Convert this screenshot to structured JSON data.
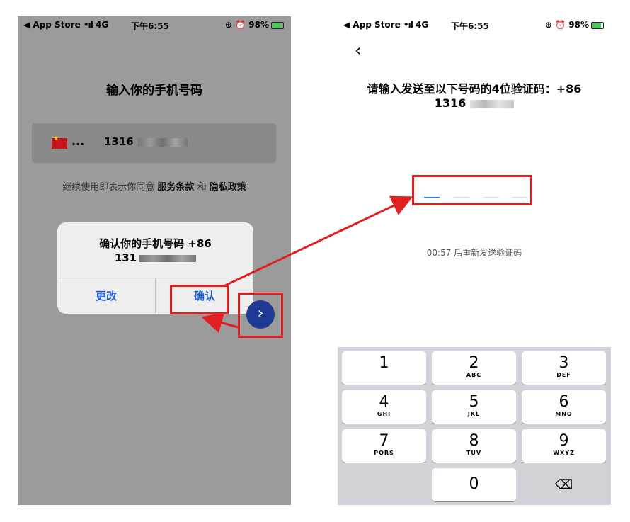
{
  "left_screen": {
    "status": {
      "carrier": "◀ App Store",
      "signal": "•ıl",
      "network": "4G",
      "time": "下午6:55",
      "icons": "⊕ ⏰",
      "battery": "98%"
    },
    "title": "输入你的手机号码",
    "phone_row": {
      "dots": "...",
      "number_prefix": "1316"
    },
    "terms": {
      "prefix": "继续使用即表示你同意",
      "terms_link": "服务条款",
      "and": "和",
      "privacy_link": "隐私政策"
    },
    "alert": {
      "title_line1": "确认你的手机号码 +86",
      "title_line2_prefix": "131",
      "change_label": "更改",
      "confirm_label": "确认"
    },
    "next_icon": "›"
  },
  "right_screen": {
    "status": {
      "carrier": "◀ App Store",
      "signal": "•ıl",
      "network": "4G",
      "time": "下午6:55",
      "icons": "⊕ ⏰",
      "battery": "98%"
    },
    "back_icon": "‹",
    "title_line1": "请输入发送至以下号码的4位验证码：+86",
    "title_line2_prefix": "1316",
    "resend": "00:57 后重新发送验证码",
    "keys": [
      {
        "digit": "1",
        "letters": ""
      },
      {
        "digit": "2",
        "letters": "ABC"
      },
      {
        "digit": "3",
        "letters": "DEF"
      },
      {
        "digit": "4",
        "letters": "GHI"
      },
      {
        "digit": "5",
        "letters": "JKL"
      },
      {
        "digit": "6",
        "letters": "MNO"
      },
      {
        "digit": "7",
        "letters": "PQRS"
      },
      {
        "digit": "8",
        "letters": "TUV"
      },
      {
        "digit": "9",
        "letters": "WXYZ"
      },
      {
        "digit": "0",
        "letters": ""
      },
      {
        "digit": "⌫",
        "letters": ""
      }
    ]
  },
  "colors": {
    "highlight": "#e02020",
    "link_blue": "#1f5bd6",
    "next_button": "#1f3a93",
    "overlay_grey": "#9b9b9b"
  }
}
